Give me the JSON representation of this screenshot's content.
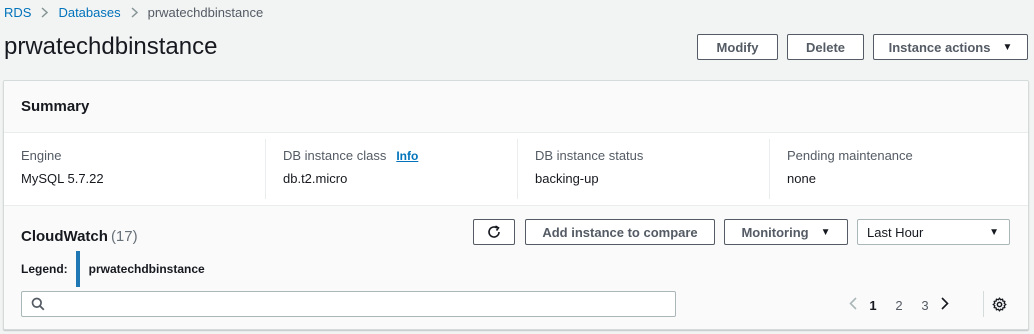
{
  "breadcrumb": {
    "items": [
      "RDS",
      "Databases"
    ],
    "current": "prwatechdbinstance"
  },
  "page": {
    "title": "prwatechdbinstance"
  },
  "actions": {
    "modify": "Modify",
    "delete": "Delete",
    "instance_actions": "Instance actions"
  },
  "summary": {
    "title": "Summary",
    "columns": [
      {
        "label": "Engine",
        "value": "MySQL 5.7.22"
      },
      {
        "label": "DB instance class",
        "info": "Info",
        "value": "db.t2.micro"
      },
      {
        "label": "DB instance status",
        "value": "backing-up"
      },
      {
        "label": "Pending maintenance",
        "value": "none"
      }
    ]
  },
  "cloudwatch": {
    "title": "CloudWatch",
    "count": "(17)",
    "legend_label": "Legend:",
    "legend_value": "prwatechdbinstance",
    "legend_color": "#1f77b4",
    "compare_button": "Add instance to compare",
    "monitoring_button": "Monitoring",
    "time_range": "Last Hour",
    "search": {
      "value": "",
      "placeholder": ""
    },
    "pagination": {
      "pages": [
        "1",
        "2",
        "3"
      ],
      "current": "1"
    }
  },
  "colors": {
    "link": "#0073bb",
    "text": "#16191f",
    "border": "#545b64",
    "background": "#f2f3f3"
  }
}
